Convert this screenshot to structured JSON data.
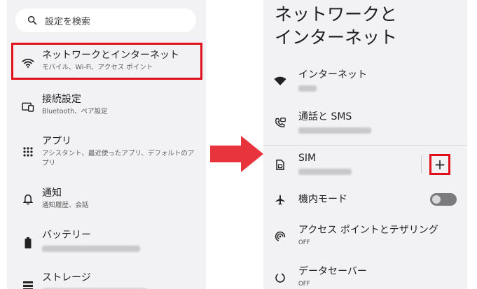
{
  "left": {
    "search_placeholder": "設定を検索",
    "items": [
      {
        "title": "ネットワークとインターネット",
        "subtitle": "モバイル、Wi-Fi、アクセス ポイント"
      },
      {
        "title": "接続設定",
        "subtitle": "Bluetooth、ペア設定"
      },
      {
        "title": "アプリ",
        "subtitle": "アシスタント、最近使ったアプリ、デフォルトのアプリ"
      },
      {
        "title": "通知",
        "subtitle": "通知履歴、会話"
      },
      {
        "title": "バッテリー",
        "subtitle": ""
      },
      {
        "title": "ストレージ",
        "subtitle": ""
      }
    ]
  },
  "right": {
    "heading_line1": "ネットワークと",
    "heading_line2": "インターネット",
    "items": [
      {
        "title": "インターネット",
        "subtitle": ""
      },
      {
        "title": "通話と SMS",
        "subtitle": ""
      },
      {
        "title": "SIM",
        "subtitle": ""
      },
      {
        "title": "機内モード",
        "subtitle": ""
      },
      {
        "title": "アクセス ポイントとテザリング",
        "subtitle": "OFF"
      },
      {
        "title": "データセーバー",
        "subtitle": "OFF"
      }
    ],
    "add_button_symbol": "+",
    "airplane_mode_on": false
  },
  "colors": {
    "panel_bg": "#f2f2f4",
    "highlight": "#e0101a",
    "arrow": "#e8343c"
  }
}
